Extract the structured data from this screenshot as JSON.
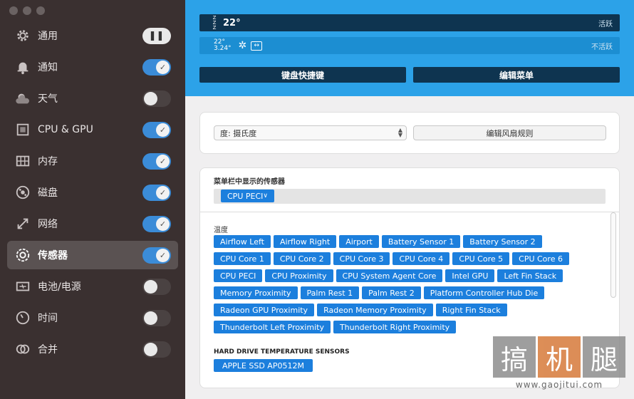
{
  "sidebar": {
    "items": [
      {
        "label": "通用",
        "icon": "gear-icon",
        "toggle": "pause",
        "active": false
      },
      {
        "label": "通知",
        "icon": "bell-icon",
        "toggle": "on",
        "active": false
      },
      {
        "label": "天气",
        "icon": "weather-icon",
        "toggle": "off",
        "active": false
      },
      {
        "label": "CPU & GPU",
        "icon": "cpu-icon",
        "toggle": "on",
        "active": false
      },
      {
        "label": "内存",
        "icon": "memory-icon",
        "toggle": "on",
        "active": false
      },
      {
        "label": "磁盘",
        "icon": "disk-icon",
        "toggle": "on",
        "active": false
      },
      {
        "label": "网络",
        "icon": "network-icon",
        "toggle": "on",
        "active": false
      },
      {
        "label": "传感器",
        "icon": "sensor-fan-icon",
        "toggle": "on",
        "active": true
      },
      {
        "label": "电池/电源",
        "icon": "battery-icon",
        "toggle": "off",
        "active": false
      },
      {
        "label": "时间",
        "icon": "clock-icon",
        "toggle": "off",
        "active": false
      },
      {
        "label": "合并",
        "icon": "merge-icon",
        "toggle": "off",
        "active": false
      }
    ]
  },
  "header": {
    "bar1": {
      "zzz": "Z Z Z",
      "temp": "22°",
      "state": "活跃"
    },
    "bar2": {
      "temp_line1": "22°",
      "temp_line2": "3.24°",
      "state": "不活跃"
    },
    "shortcut_button": "键盘快捷键",
    "edit_menu_button": "编辑菜单"
  },
  "units": {
    "select_value": "度:  摄氏度",
    "fan_rules_button": "编辑风扇规则"
  },
  "sensors": {
    "menubar_title": "菜单栏中显示的传感器",
    "menubar_chip": "CPU PECI ",
    "temperature_label": "温度",
    "temperature_chips": [
      "Airflow Left",
      "Airflow Right",
      "Airport",
      "Battery Sensor 1",
      "Battery Sensor 2",
      "CPU Core 1",
      "CPU Core 2",
      "CPU Core 3",
      "CPU Core 4",
      "CPU Core 5",
      "CPU Core 6",
      "CPU PECI",
      "CPU Proximity",
      "CPU System Agent Core",
      "Intel GPU",
      "Left Fin Stack",
      "Memory Proximity",
      "Palm Rest 1",
      "Palm Rest 2",
      "Platform Controller Hub Die",
      "Radeon GPU Proximity",
      "Radeon Memory Proximity",
      "Right Fin Stack",
      "Thunderbolt Left Proximity",
      "Thunderbolt Right Proximity"
    ],
    "hard_drive_label": "HARD DRIVE TEMPERATURE SENSORS",
    "hard_drive_chips": [
      "APPLE SSD AP0512M"
    ]
  },
  "watermark": {
    "tiles": [
      "搞",
      "机",
      "腿"
    ],
    "url": "www.gaojitui.com"
  },
  "colors": {
    "sidebar_bg": "#3a3030",
    "accent_blue": "#2ca2e8",
    "chip_blue": "#1c7fdd",
    "dark_bar": "#0e3450"
  }
}
